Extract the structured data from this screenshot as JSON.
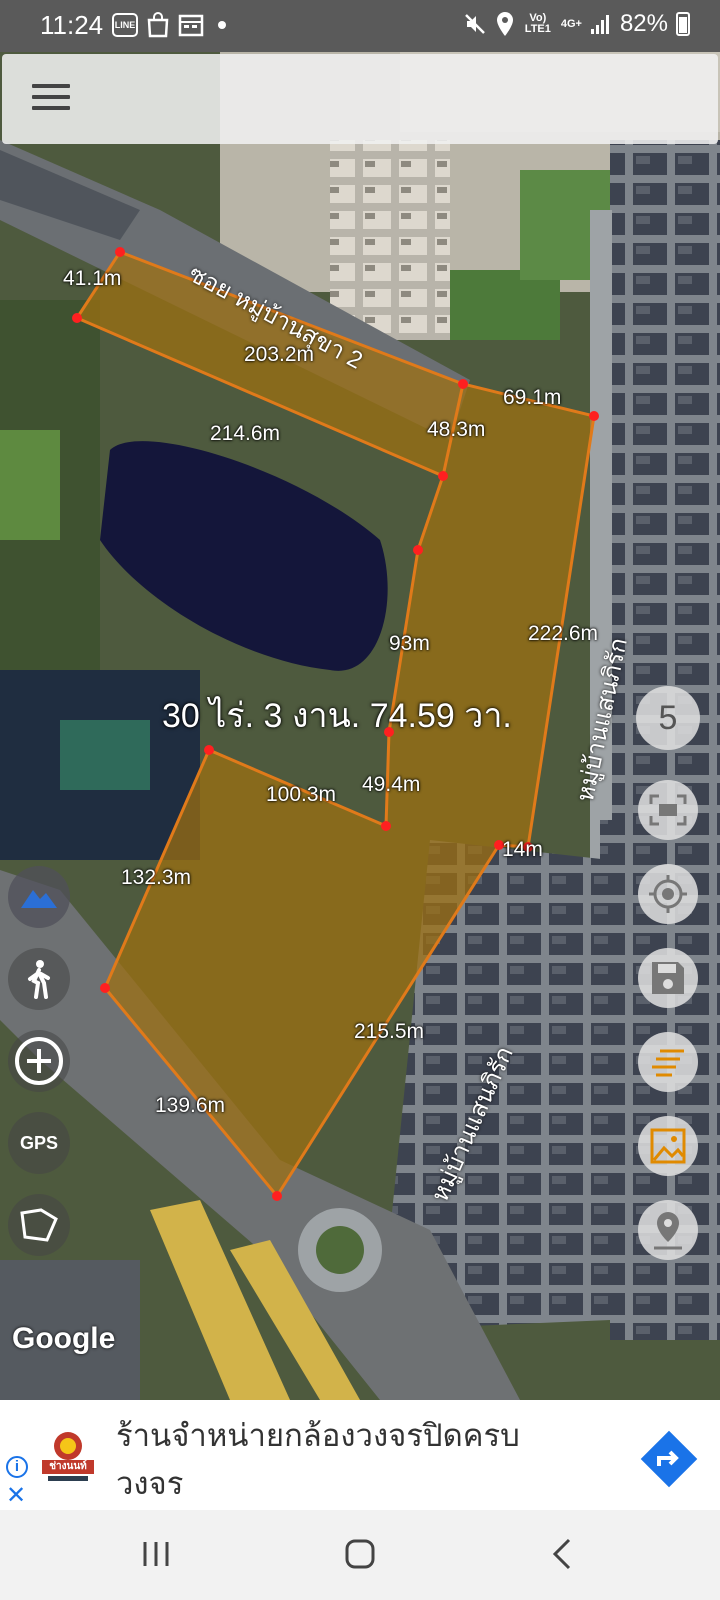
{
  "status_bar": {
    "time": "11:24",
    "left_icons": [
      "line-icon",
      "shopping-bag-icon",
      "calendar-icon",
      "notification-dot"
    ],
    "network_volte": "Vo) LTE1",
    "network_type": "4G+",
    "battery": "82%"
  },
  "map": {
    "area_label": "30 ไร่. 3 งาน. 74.59 วา.",
    "road_labels": {
      "soi": "ซอย หมู่บ้านสุขา 2",
      "village_right": "หมู่บ้านแสนภิรัก",
      "village_bottom": "หมู่บ้านแสนภิรัก"
    },
    "measurements": [
      {
        "id": "m1",
        "label": "41.1m"
      },
      {
        "id": "m2",
        "label": "203.2m"
      },
      {
        "id": "m3",
        "label": "214.6m"
      },
      {
        "id": "m4",
        "label": "48.3m"
      },
      {
        "id": "m5",
        "label": "69.1m"
      },
      {
        "id": "m6",
        "label": "222.6m"
      },
      {
        "id": "m7",
        "label": "93m"
      },
      {
        "id": "m8",
        "label": "49.4m"
      },
      {
        "id": "m9",
        "label": "100.3m"
      },
      {
        "id": "m10",
        "label": "14m"
      },
      {
        "id": "m11",
        "label": "132.3m"
      },
      {
        "id": "m12",
        "label": "215.5m"
      },
      {
        "id": "m13",
        "label": "139.6m"
      }
    ],
    "zoom_level": "5",
    "gps_label": "GPS",
    "attribution": "Google",
    "colors": {
      "parcel_fill": "#a0700f",
      "parcel_stroke": "#e07a1a",
      "vertex": "#ff2020",
      "orange_icon": "#e08a00"
    }
  },
  "left_controls": [
    "terrain-icon",
    "walk-icon",
    "add-point-icon",
    "GPS",
    "polygon-icon"
  ],
  "right_controls": [
    "zoom-level",
    "fit-screen-icon",
    "locate-icon",
    "save-icon",
    "layers-icon",
    "image-icon",
    "location-pin-icon"
  ],
  "ad": {
    "text": "ร้านจำหน่ายกล้องวงจรปิดครบวงจร",
    "logo_text": "ช่างนนท์",
    "info_icon": "i",
    "close_icon": "✕"
  },
  "nav_bar": [
    "recents-icon",
    "home-icon",
    "back-icon"
  ]
}
